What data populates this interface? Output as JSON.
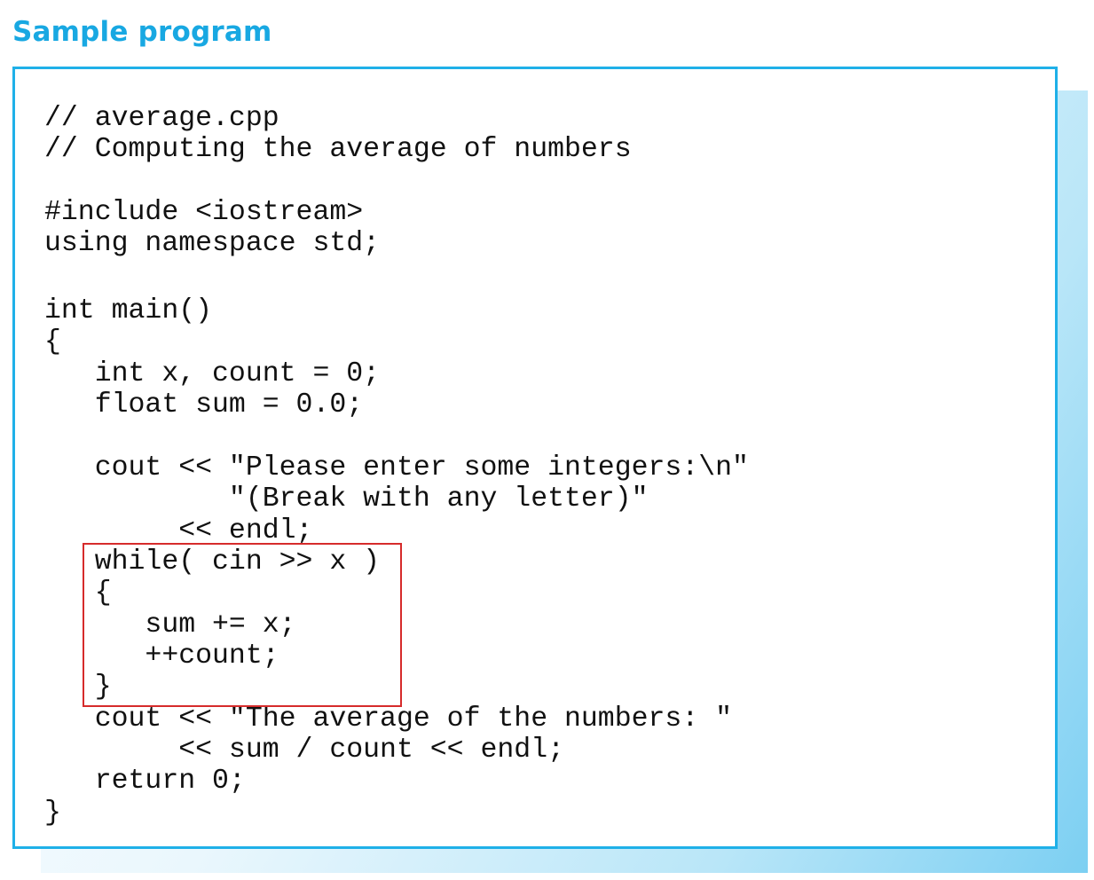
{
  "title": "Sample program",
  "colors": {
    "title": "#18a8e2",
    "frame": "#1fb0e8",
    "highlight": "#d62b2b"
  },
  "code_lines": [
    "// average.cpp",
    "// Computing the average of numbers",
    "#include <iostream>",
    "using namespace std;",
    "int main()",
    "{",
    "   int x, count = 0;",
    "   float sum = 0.0;",
    "   cout << \"Please enter some integers:\\n\"",
    "           \"(Break with any letter)\"",
    "        << endl;",
    "   while( cin >> x )",
    "   {",
    "      sum += x;",
    "      ++count;",
    "   }",
    "   cout << \"The average of the numbers: \"",
    "        << sum / count << endl;",
    "   return 0;",
    "}"
  ]
}
